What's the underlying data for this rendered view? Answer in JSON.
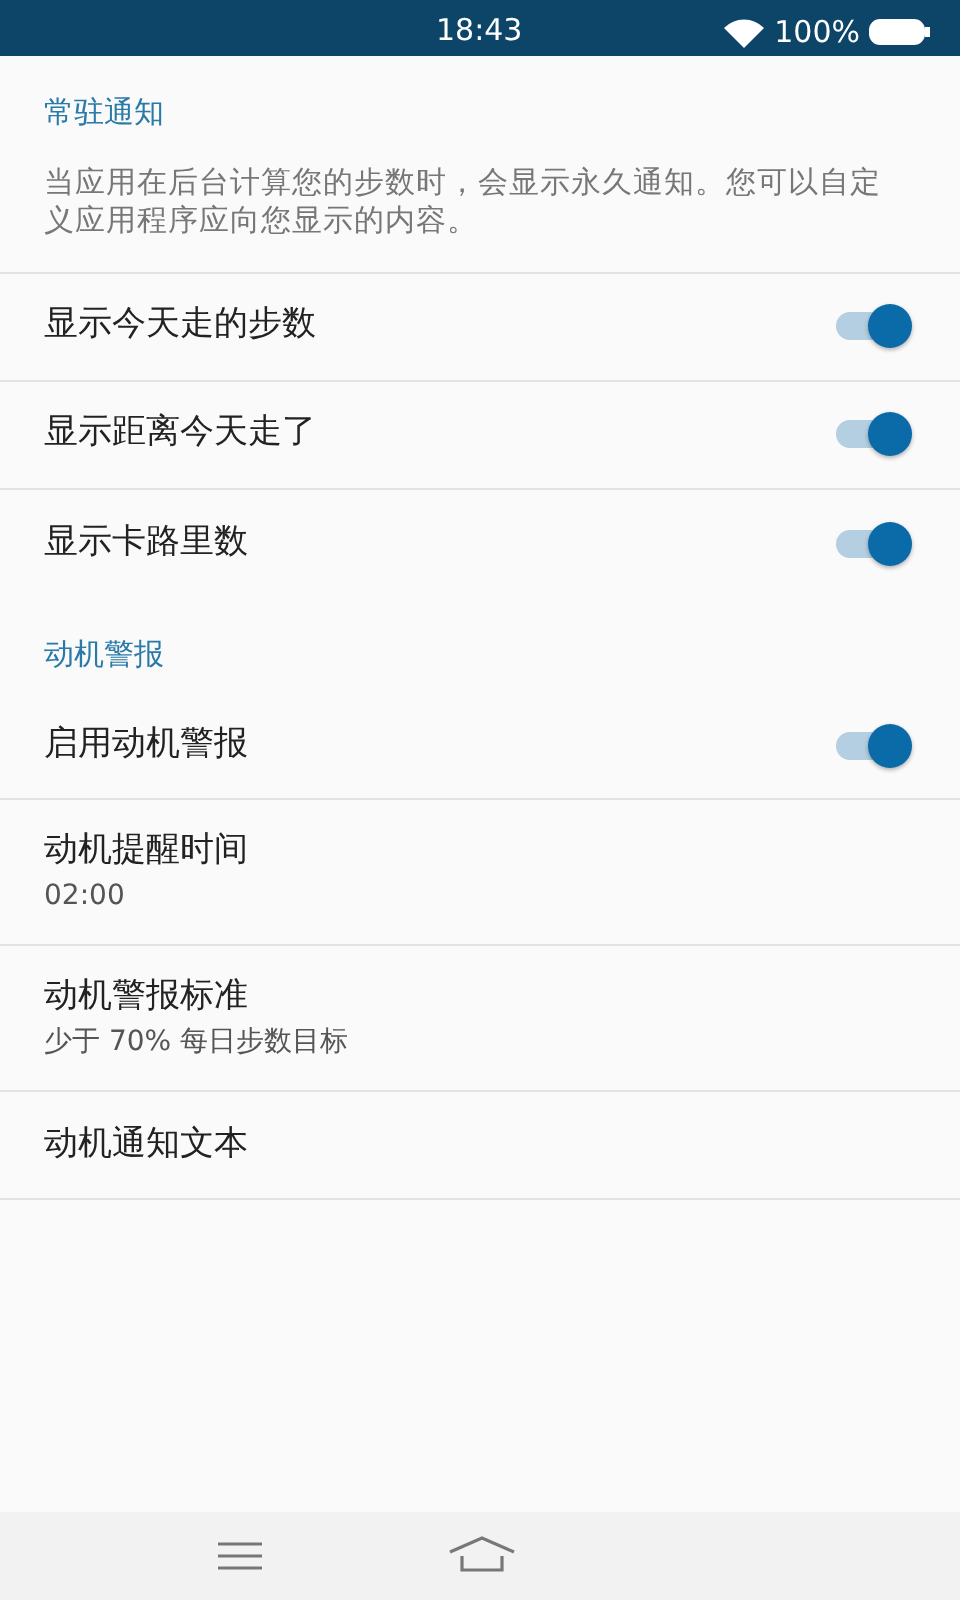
{
  "status_bar": {
    "time": "18:43",
    "battery": "100%"
  },
  "sections": [
    {
      "title": "常驻通知",
      "description": "当应用在后台计算您的步数时，会显示永久通知。您可以自定义应用程序应向您显示的内容。",
      "items": [
        {
          "kind": "switch",
          "label": "显示今天走的步数",
          "on": true
        },
        {
          "kind": "switch",
          "label": "显示距离今天走了",
          "on": true
        },
        {
          "kind": "switch",
          "label": "显示卡路里数",
          "on": true
        }
      ]
    },
    {
      "title": "动机警报",
      "items": [
        {
          "kind": "switch",
          "label": "启用动机警报",
          "on": true
        },
        {
          "kind": "detail",
          "label": "动机提醒时间",
          "summary": "02:00"
        },
        {
          "kind": "detail",
          "label": "动机警报标准",
          "summary": "少于 70% 每日步数目标"
        },
        {
          "kind": "plain",
          "label": "动机通知文本"
        }
      ]
    }
  ]
}
